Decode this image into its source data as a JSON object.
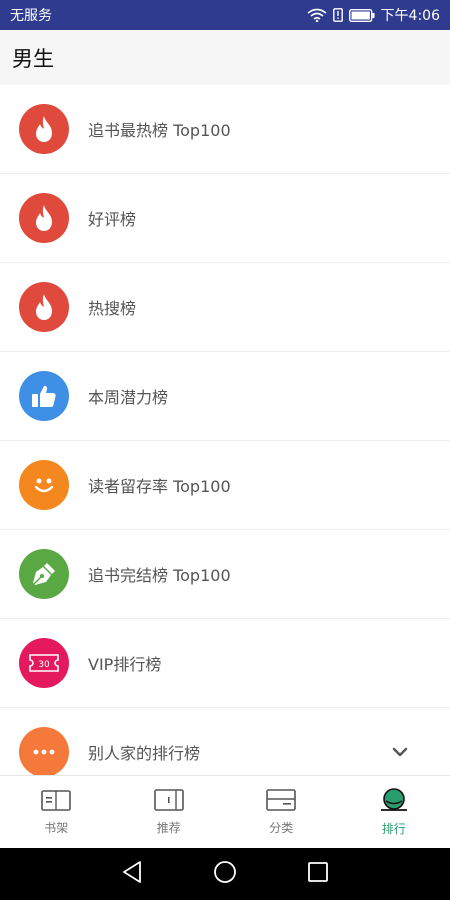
{
  "status_bar": {
    "carrier": "无服务",
    "time": "下午4:06"
  },
  "header": {
    "title": "男生"
  },
  "rankings": [
    {
      "label": "追书最热榜 Top100",
      "icon": "flame-icon",
      "color": "#e04a3c"
    },
    {
      "label": "好评榜",
      "icon": "flame-icon",
      "color": "#e04a3c"
    },
    {
      "label": "热搜榜",
      "icon": "flame-icon",
      "color": "#e04a3c"
    },
    {
      "label": "本周潜力榜",
      "icon": "thumbs-up-icon",
      "color": "#3e8fe6"
    },
    {
      "label": "读者留存率 Top100",
      "icon": "smiley-icon",
      "color": "#f5871f"
    },
    {
      "label": "追书完结榜 Top100",
      "icon": "pen-nib-icon",
      "color": "#5aa844"
    },
    {
      "label": "VIP排行榜",
      "icon": "ticket-icon",
      "color": "#e5195d",
      "badge": "30"
    },
    {
      "label": "别人家的排行榜",
      "icon": "more-dots-icon",
      "color": "#f5793b"
    }
  ],
  "tabs": [
    {
      "label": "书架",
      "icon": "bookshelf-icon",
      "active": false
    },
    {
      "label": "推荐",
      "icon": "recommend-icon",
      "active": false
    },
    {
      "label": "分类",
      "icon": "category-icon",
      "active": false
    },
    {
      "label": "排行",
      "icon": "ranking-icon",
      "active": true
    }
  ],
  "colors": {
    "status_bar": "#2e3b8f",
    "active_tab": "#2a9d6f"
  }
}
